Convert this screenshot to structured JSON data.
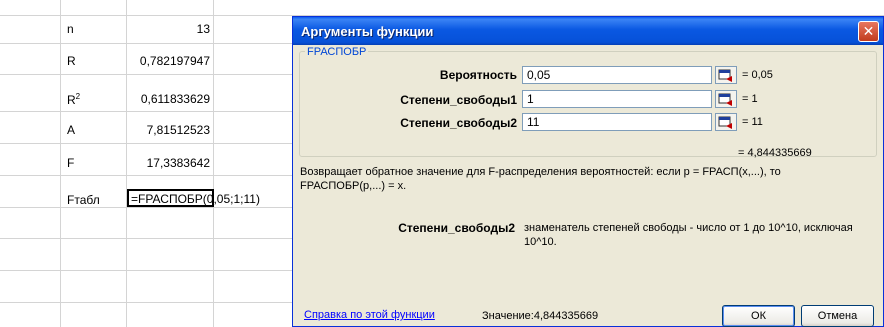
{
  "sheet": {
    "rows": [
      {
        "label": "n",
        "value": "13"
      },
      {
        "label": "R",
        "value": "0,782197947"
      },
      {
        "label": "R",
        "label_sup": "2",
        "value": "0,611833629"
      },
      {
        "label": "A",
        "value": "7,81512523"
      },
      {
        "label": "F",
        "value": "17,3383642"
      },
      {
        "label": "Fтабл"
      }
    ],
    "formula_cell": "=FРАСПОБР",
    "formula_tail": "(0,05;1;11)"
  },
  "dialog": {
    "title": "Аргументы функции",
    "function_name": "FРАСПОБР",
    "args": [
      {
        "label": "Вероятность",
        "value": "0,05",
        "result": "= 0,05"
      },
      {
        "label": "Степени_свободы1",
        "value": "1",
        "result": "= 1"
      },
      {
        "label": "Степени_свободы2",
        "value": "11",
        "result": "= 11"
      }
    ],
    "total_result": "= 4,844335669",
    "description": "Возвращает обратное значение для F-распределения вероятностей: если р = FРАСП(x,...), то FРАСПОБР(р,...) = х.",
    "param_name": "Степени_свободы2",
    "param_description": "знаменатель степеней свободы - число от 1 до 10^10, исключая 10^10.",
    "help_link": "Справка по этой функции",
    "value_label": "Значение:",
    "value": "4,844335669",
    "ok_label": "ОК",
    "cancel_label": "Отмена"
  }
}
